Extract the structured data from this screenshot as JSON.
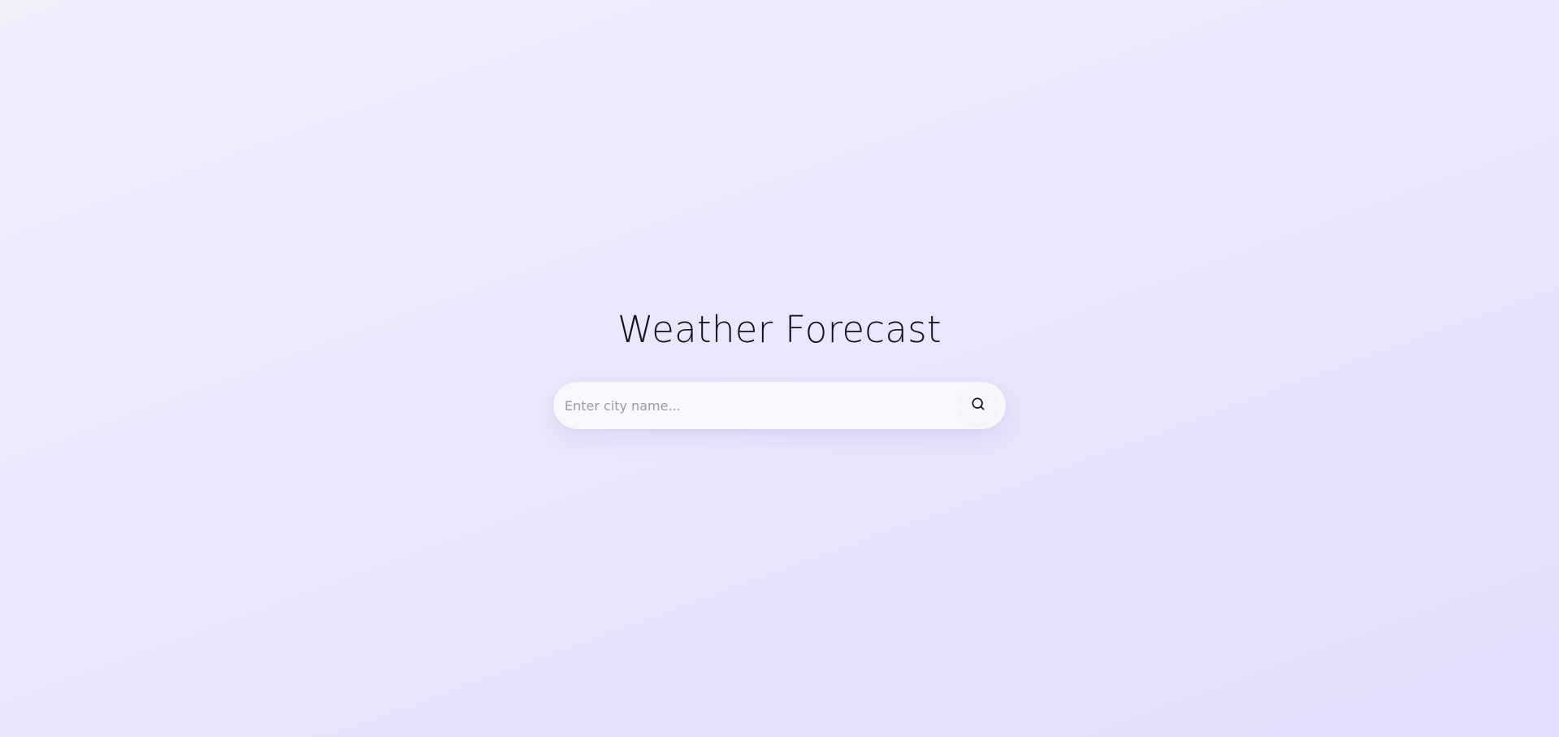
{
  "header": {
    "title": "Weather Forecast"
  },
  "search": {
    "placeholder": "Enter city name...",
    "value": "",
    "button_icon": "search-icon"
  },
  "colors": {
    "background_start": "#f1effc",
    "background_end": "#e4ddfc",
    "search_bar": "#f7f7fc",
    "title_text": "#12121c"
  }
}
